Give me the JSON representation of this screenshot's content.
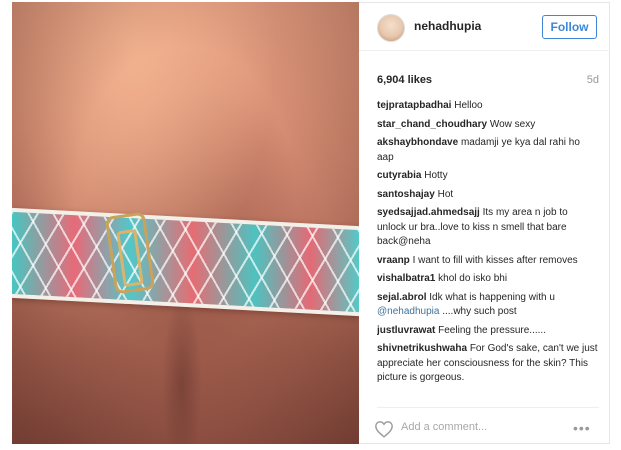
{
  "post": {
    "username": "nehadhupia",
    "follow_label": "Follow",
    "likes": "6,904 likes",
    "age": "5d",
    "add_comment_placeholder": "Add a comment...",
    "more_label": "•••",
    "accent": "#3f86d6"
  },
  "comments": [
    {
      "user": "tejpratapbadhai",
      "text": "Helloo"
    },
    {
      "user": "star_chand_choudhary",
      "text": "Wow sexy"
    },
    {
      "user": "akshaybhondave",
      "text": "madamji ye kya dal rahi ho aap"
    },
    {
      "user": "cutyrabia",
      "text": "Hotty"
    },
    {
      "user": "santoshajay",
      "text": "Hot"
    },
    {
      "user": "syedsajjad.ahmedsajj",
      "text": "Its my area n job to unlock ur bra..love to kiss n smell that bare back@neha"
    },
    {
      "user": "vraanp",
      "text": "I want to fill with kisses after removes"
    },
    {
      "user": "vishalbatra1",
      "text": "khol do isko bhi"
    },
    {
      "user": "sejal.abrol",
      "text": "Idk what is happening with u",
      "mention": "@nehadhupia",
      "text2": "....why such post"
    },
    {
      "user": "justluvrawat",
      "text": "Feeling the pressure......"
    },
    {
      "user": "shivnetrikushwaha",
      "text": "For God's sake, can't we just appreciate her consciousness for the skin? This picture is gorgeous."
    }
  ]
}
